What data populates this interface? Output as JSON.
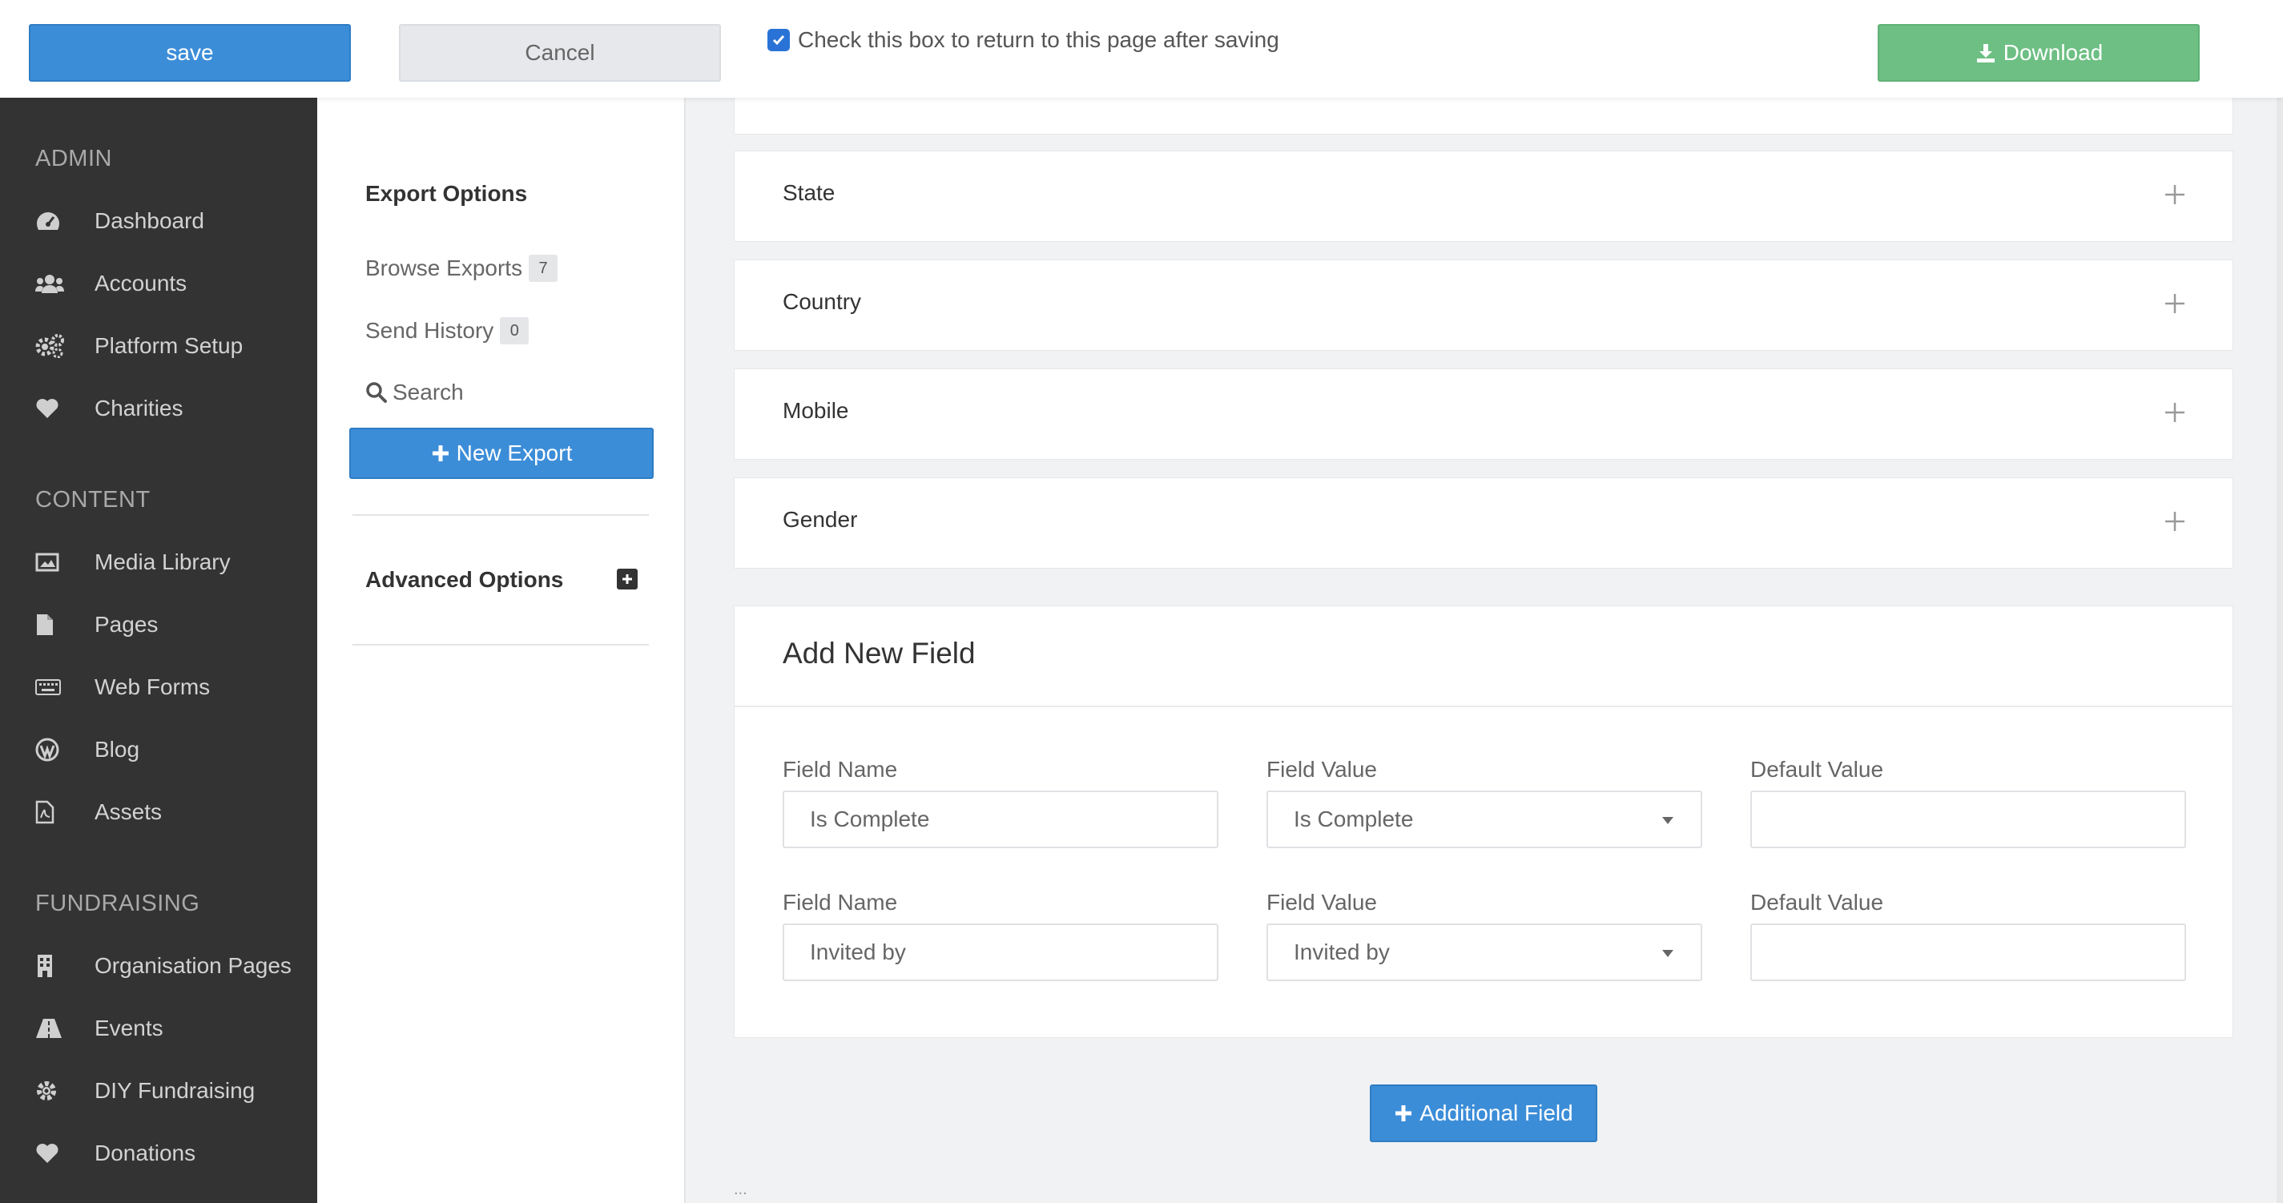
{
  "topbar": {
    "save_label": "save",
    "cancel_label": "Cancel",
    "return_checkbox_label": "Check this box to return to this page after saving",
    "return_checked": true,
    "download_label": "Download"
  },
  "sidebar": {
    "sections": [
      {
        "heading": "ADMIN",
        "items": [
          {
            "label": "Dashboard",
            "icon": "dashboard-icon"
          },
          {
            "label": "Accounts",
            "icon": "users-icon"
          },
          {
            "label": "Platform Setup",
            "icon": "gears-icon"
          },
          {
            "label": "Charities",
            "icon": "heart-icon"
          }
        ]
      },
      {
        "heading": "CONTENT",
        "items": [
          {
            "label": "Media Library",
            "icon": "image-icon"
          },
          {
            "label": "Pages",
            "icon": "file-icon"
          },
          {
            "label": "Web Forms",
            "icon": "keyboard-icon"
          },
          {
            "label": "Blog",
            "icon": "wordpress-icon"
          },
          {
            "label": "Assets",
            "icon": "file-pdf-icon"
          }
        ]
      },
      {
        "heading": "FUNDRAISING",
        "items": [
          {
            "label": "Organisation Pages",
            "icon": "building-icon"
          },
          {
            "label": "Events",
            "icon": "road-icon"
          },
          {
            "label": "DIY Fundraising",
            "icon": "gear-icon"
          },
          {
            "label": "Donations",
            "icon": "heart-icon"
          }
        ]
      }
    ]
  },
  "midcol": {
    "export_options_title": "Export Options",
    "browse_exports_label": "Browse Exports",
    "browse_exports_count": "7",
    "send_history_label": "Send History",
    "send_history_count": "0",
    "search_label": "Search",
    "new_export_label": "New Export",
    "advanced_options_title": "Advanced Options"
  },
  "accordion": {
    "items": [
      "State",
      "Country",
      "Mobile",
      "Gender"
    ]
  },
  "add_field_panel": {
    "title": "Add New Field",
    "rows": [
      {
        "name_label": "Field Name",
        "name_value": "Is Complete",
        "value_label": "Field Value",
        "value_selected": "Is Complete",
        "default_label": "Default Value",
        "default_value": ""
      },
      {
        "name_label": "Field Name",
        "name_value": "Invited by",
        "value_label": "Field Value",
        "value_selected": "Invited by",
        "default_label": "Default Value",
        "default_value": ""
      }
    ]
  },
  "additional_field_label": "Additional Field",
  "footer_dots": "...",
  "colors": {
    "primary": "#3c8dd8",
    "success": "#6dbf83",
    "sidebar": "#333334"
  }
}
